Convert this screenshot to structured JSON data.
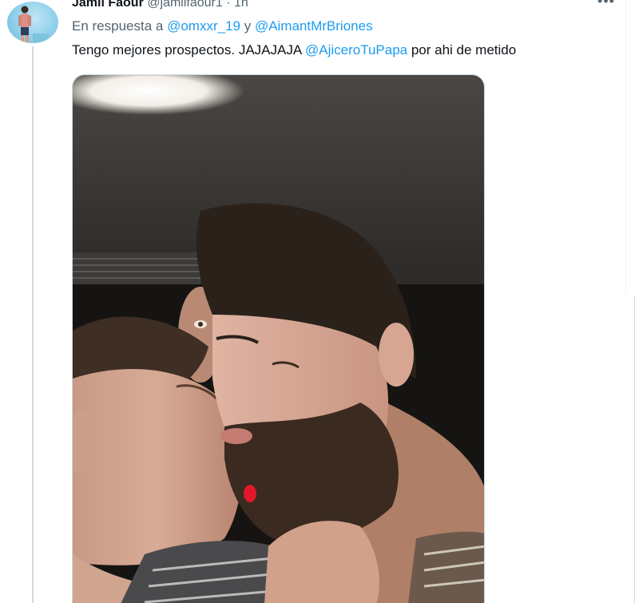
{
  "tweet": {
    "author_name": "Jamil Faour",
    "author_handle": "@jamilfaour1",
    "separator": "·",
    "time": "1h",
    "more_label": "•••",
    "reply_prefix": "En respuesta a ",
    "reply_user_1": "@omxxr_19",
    "reply_joiner": " y ",
    "reply_user_2": "@AimantMrBriones",
    "text_before": "Tengo mejores prospectos. JAJAJAJA ",
    "text_mention": "@AjiceroTuPapa",
    "text_after": " por ahi de metido"
  },
  "colors": {
    "mention": "#1d9bf0",
    "secondary_text": "#536471",
    "primary_text": "#0f1419",
    "thread_line": "#cfd9de"
  },
  "icons": {
    "avatar": "profile-photo",
    "more": "more-horizontal-icon"
  }
}
